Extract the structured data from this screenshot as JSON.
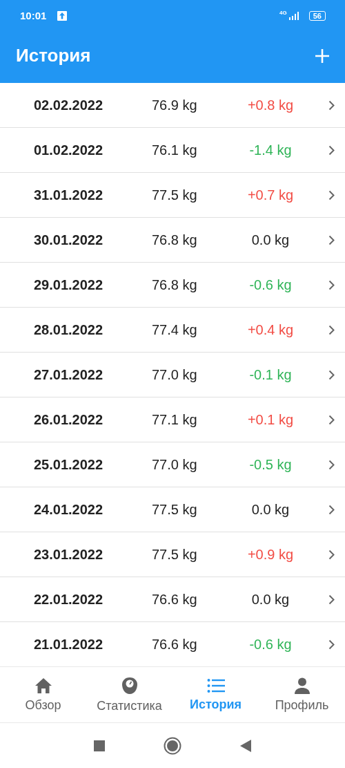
{
  "status_bar": {
    "time": "10:01",
    "network": "4G",
    "battery": "56"
  },
  "app_bar": {
    "title": "История"
  },
  "entries": [
    {
      "date": "02.02.2022",
      "weight": "76.9 kg",
      "change": "+0.8 kg",
      "kind": "up"
    },
    {
      "date": "01.02.2022",
      "weight": "76.1 kg",
      "change": "-1.4 kg",
      "kind": "down"
    },
    {
      "date": "31.01.2022",
      "weight": "77.5 kg",
      "change": "+0.7 kg",
      "kind": "up"
    },
    {
      "date": "30.01.2022",
      "weight": "76.8 kg",
      "change": "0.0 kg",
      "kind": "zero"
    },
    {
      "date": "29.01.2022",
      "weight": "76.8 kg",
      "change": "-0.6 kg",
      "kind": "down"
    },
    {
      "date": "28.01.2022",
      "weight": "77.4 kg",
      "change": "+0.4 kg",
      "kind": "up"
    },
    {
      "date": "27.01.2022",
      "weight": "77.0 kg",
      "change": "-0.1 kg",
      "kind": "down"
    },
    {
      "date": "26.01.2022",
      "weight": "77.1 kg",
      "change": "+0.1 kg",
      "kind": "up"
    },
    {
      "date": "25.01.2022",
      "weight": "77.0 kg",
      "change": "-0.5 kg",
      "kind": "down"
    },
    {
      "date": "24.01.2022",
      "weight": "77.5 kg",
      "change": "0.0 kg",
      "kind": "zero"
    },
    {
      "date": "23.01.2022",
      "weight": "77.5 kg",
      "change": "+0.9 kg",
      "kind": "up"
    },
    {
      "date": "22.01.2022",
      "weight": "76.6 kg",
      "change": "0.0 kg",
      "kind": "zero"
    },
    {
      "date": "21.01.2022",
      "weight": "76.6 kg",
      "change": "-0.6 kg",
      "kind": "down"
    }
  ],
  "bottom_nav": [
    {
      "label": "Обзор",
      "kind": "home",
      "selected": false
    },
    {
      "label": "Статистика",
      "kind": "scale",
      "selected": false
    },
    {
      "label": "История",
      "kind": "list",
      "selected": true
    },
    {
      "label": "Профиль",
      "kind": "person",
      "selected": false
    }
  ]
}
